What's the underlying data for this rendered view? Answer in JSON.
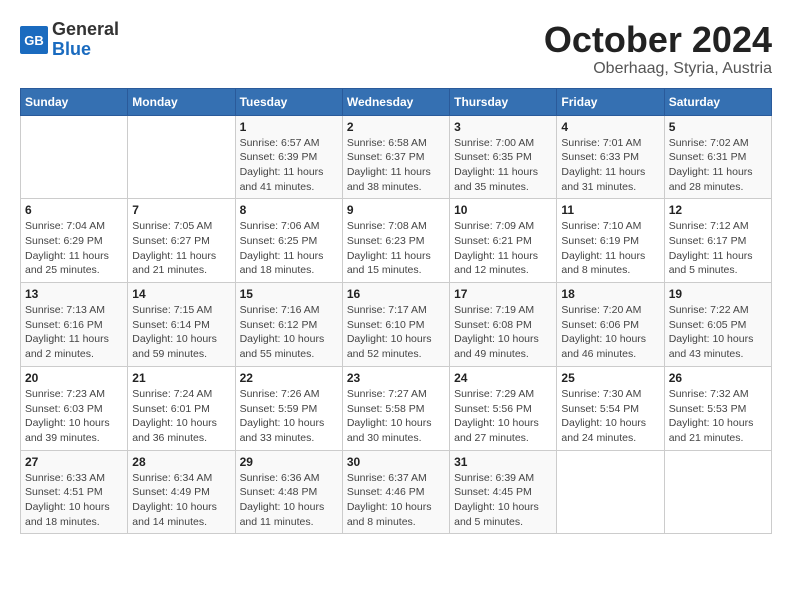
{
  "header": {
    "logo_general": "General",
    "logo_blue": "Blue",
    "month_title": "October 2024",
    "location": "Oberhaag, Styria, Austria"
  },
  "weekdays": [
    "Sunday",
    "Monday",
    "Tuesday",
    "Wednesday",
    "Thursday",
    "Friday",
    "Saturday"
  ],
  "weeks": [
    [
      {
        "day": "",
        "info": ""
      },
      {
        "day": "",
        "info": ""
      },
      {
        "day": "1",
        "info": "Sunrise: 6:57 AM\nSunset: 6:39 PM\nDaylight: 11 hours\nand 41 minutes."
      },
      {
        "day": "2",
        "info": "Sunrise: 6:58 AM\nSunset: 6:37 PM\nDaylight: 11 hours\nand 38 minutes."
      },
      {
        "day": "3",
        "info": "Sunrise: 7:00 AM\nSunset: 6:35 PM\nDaylight: 11 hours\nand 35 minutes."
      },
      {
        "day": "4",
        "info": "Sunrise: 7:01 AM\nSunset: 6:33 PM\nDaylight: 11 hours\nand 31 minutes."
      },
      {
        "day": "5",
        "info": "Sunrise: 7:02 AM\nSunset: 6:31 PM\nDaylight: 11 hours\nand 28 minutes."
      }
    ],
    [
      {
        "day": "6",
        "info": "Sunrise: 7:04 AM\nSunset: 6:29 PM\nDaylight: 11 hours\nand 25 minutes."
      },
      {
        "day": "7",
        "info": "Sunrise: 7:05 AM\nSunset: 6:27 PM\nDaylight: 11 hours\nand 21 minutes."
      },
      {
        "day": "8",
        "info": "Sunrise: 7:06 AM\nSunset: 6:25 PM\nDaylight: 11 hours\nand 18 minutes."
      },
      {
        "day": "9",
        "info": "Sunrise: 7:08 AM\nSunset: 6:23 PM\nDaylight: 11 hours\nand 15 minutes."
      },
      {
        "day": "10",
        "info": "Sunrise: 7:09 AM\nSunset: 6:21 PM\nDaylight: 11 hours\nand 12 minutes."
      },
      {
        "day": "11",
        "info": "Sunrise: 7:10 AM\nSunset: 6:19 PM\nDaylight: 11 hours\nand 8 minutes."
      },
      {
        "day": "12",
        "info": "Sunrise: 7:12 AM\nSunset: 6:17 PM\nDaylight: 11 hours\nand 5 minutes."
      }
    ],
    [
      {
        "day": "13",
        "info": "Sunrise: 7:13 AM\nSunset: 6:16 PM\nDaylight: 11 hours\nand 2 minutes."
      },
      {
        "day": "14",
        "info": "Sunrise: 7:15 AM\nSunset: 6:14 PM\nDaylight: 10 hours\nand 59 minutes."
      },
      {
        "day": "15",
        "info": "Sunrise: 7:16 AM\nSunset: 6:12 PM\nDaylight: 10 hours\nand 55 minutes."
      },
      {
        "day": "16",
        "info": "Sunrise: 7:17 AM\nSunset: 6:10 PM\nDaylight: 10 hours\nand 52 minutes."
      },
      {
        "day": "17",
        "info": "Sunrise: 7:19 AM\nSunset: 6:08 PM\nDaylight: 10 hours\nand 49 minutes."
      },
      {
        "day": "18",
        "info": "Sunrise: 7:20 AM\nSunset: 6:06 PM\nDaylight: 10 hours\nand 46 minutes."
      },
      {
        "day": "19",
        "info": "Sunrise: 7:22 AM\nSunset: 6:05 PM\nDaylight: 10 hours\nand 43 minutes."
      }
    ],
    [
      {
        "day": "20",
        "info": "Sunrise: 7:23 AM\nSunset: 6:03 PM\nDaylight: 10 hours\nand 39 minutes."
      },
      {
        "day": "21",
        "info": "Sunrise: 7:24 AM\nSunset: 6:01 PM\nDaylight: 10 hours\nand 36 minutes."
      },
      {
        "day": "22",
        "info": "Sunrise: 7:26 AM\nSunset: 5:59 PM\nDaylight: 10 hours\nand 33 minutes."
      },
      {
        "day": "23",
        "info": "Sunrise: 7:27 AM\nSunset: 5:58 PM\nDaylight: 10 hours\nand 30 minutes."
      },
      {
        "day": "24",
        "info": "Sunrise: 7:29 AM\nSunset: 5:56 PM\nDaylight: 10 hours\nand 27 minutes."
      },
      {
        "day": "25",
        "info": "Sunrise: 7:30 AM\nSunset: 5:54 PM\nDaylight: 10 hours\nand 24 minutes."
      },
      {
        "day": "26",
        "info": "Sunrise: 7:32 AM\nSunset: 5:53 PM\nDaylight: 10 hours\nand 21 minutes."
      }
    ],
    [
      {
        "day": "27",
        "info": "Sunrise: 6:33 AM\nSunset: 4:51 PM\nDaylight: 10 hours\nand 18 minutes."
      },
      {
        "day": "28",
        "info": "Sunrise: 6:34 AM\nSunset: 4:49 PM\nDaylight: 10 hours\nand 14 minutes."
      },
      {
        "day": "29",
        "info": "Sunrise: 6:36 AM\nSunset: 4:48 PM\nDaylight: 10 hours\nand 11 minutes."
      },
      {
        "day": "30",
        "info": "Sunrise: 6:37 AM\nSunset: 4:46 PM\nDaylight: 10 hours\nand 8 minutes."
      },
      {
        "day": "31",
        "info": "Sunrise: 6:39 AM\nSunset: 4:45 PM\nDaylight: 10 hours\nand 5 minutes."
      },
      {
        "day": "",
        "info": ""
      },
      {
        "day": "",
        "info": ""
      }
    ]
  ]
}
